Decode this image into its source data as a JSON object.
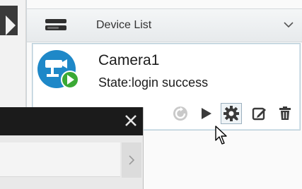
{
  "panel": {
    "title": "Device List",
    "icons": {
      "header": "device-list-icon",
      "collapse": "chevron-down-icon"
    }
  },
  "device": {
    "name": "Camera1",
    "state": "State:login success",
    "icon": "camera-device-icon",
    "badge": "play-badge-icon"
  },
  "actions": [
    {
      "name": "refresh-icon"
    },
    {
      "name": "play-icon"
    },
    {
      "name": "settings-icon"
    },
    {
      "name": "edit-icon"
    },
    {
      "name": "delete-icon"
    }
  ],
  "colors": {
    "icon_blue": "#1e88c8",
    "badge_green": "#3aa935",
    "title_bar": "#1b1b1b",
    "selection_border": "#9cb0bf"
  },
  "overlay": {
    "close": "close-icon",
    "scroll": "chevron-right-icon"
  }
}
